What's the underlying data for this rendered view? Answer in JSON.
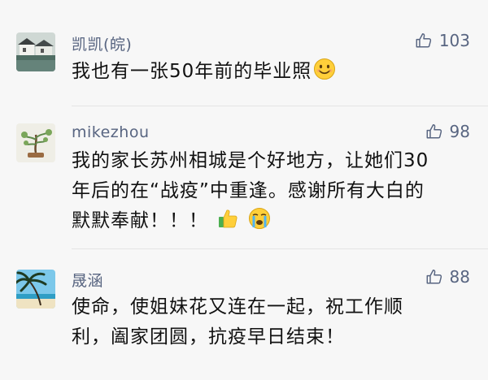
{
  "comments": [
    {
      "author": "凯凯(皖)",
      "likes": "103",
      "text": "我也有一张50年前的毕业照",
      "emoji": [
        "smile-emoji"
      ]
    },
    {
      "author": "mikezhou",
      "likes": "98",
      "text_lines": [
        "我的家长苏州相城是个好地方，让她们30",
        "年后的在“战疫”中重逢。感谢所有大白的",
        "默默奉献！！！"
      ],
      "emoji": [
        "thumbs-up-emoji",
        "crying-emoji"
      ]
    },
    {
      "author": "晟涵",
      "likes": "88",
      "text_lines": [
        "使命，使姐妹花又连在一起，祝工作顺",
        "利，阖家团圆，抗疫早日结束！"
      ]
    }
  ],
  "colors": {
    "author": "#586581",
    "text": "#111111",
    "background": "#f7f7f7"
  }
}
